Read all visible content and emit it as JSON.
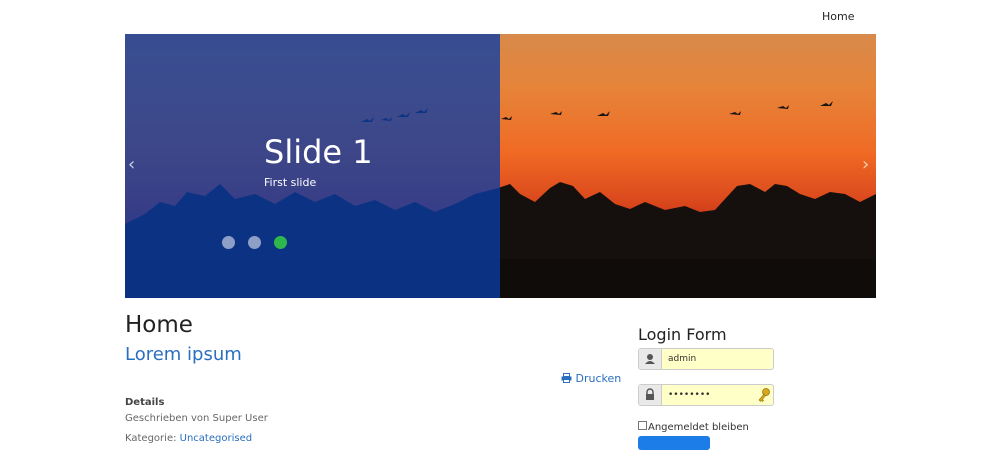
{
  "nav": {
    "home": "Home"
  },
  "slider": {
    "title": "Slide 1",
    "subtitle": "First slide",
    "prev_glyph": "‹",
    "next_glyph": "›",
    "active_index": 2,
    "dots": [
      {
        "color": "#8e9fc7"
      },
      {
        "color": "#8e9fc7"
      },
      {
        "color": "#2eb84b"
      }
    ],
    "overlay_color": "#0a3ca5"
  },
  "main": {
    "page_title": "Home",
    "article_title": "Lorem ipsum",
    "print_label": "Drucken",
    "details_heading": "Details",
    "written_by": "Geschrieben von Super User",
    "category_prefix": "Kategorie: ",
    "category_link": "Uncategorised"
  },
  "login": {
    "title": "Login Form",
    "username_value": "admin",
    "password_value": "••••••••",
    "remember_label": "Angemeldet bleiben",
    "button_color": "#1c7ce8"
  }
}
